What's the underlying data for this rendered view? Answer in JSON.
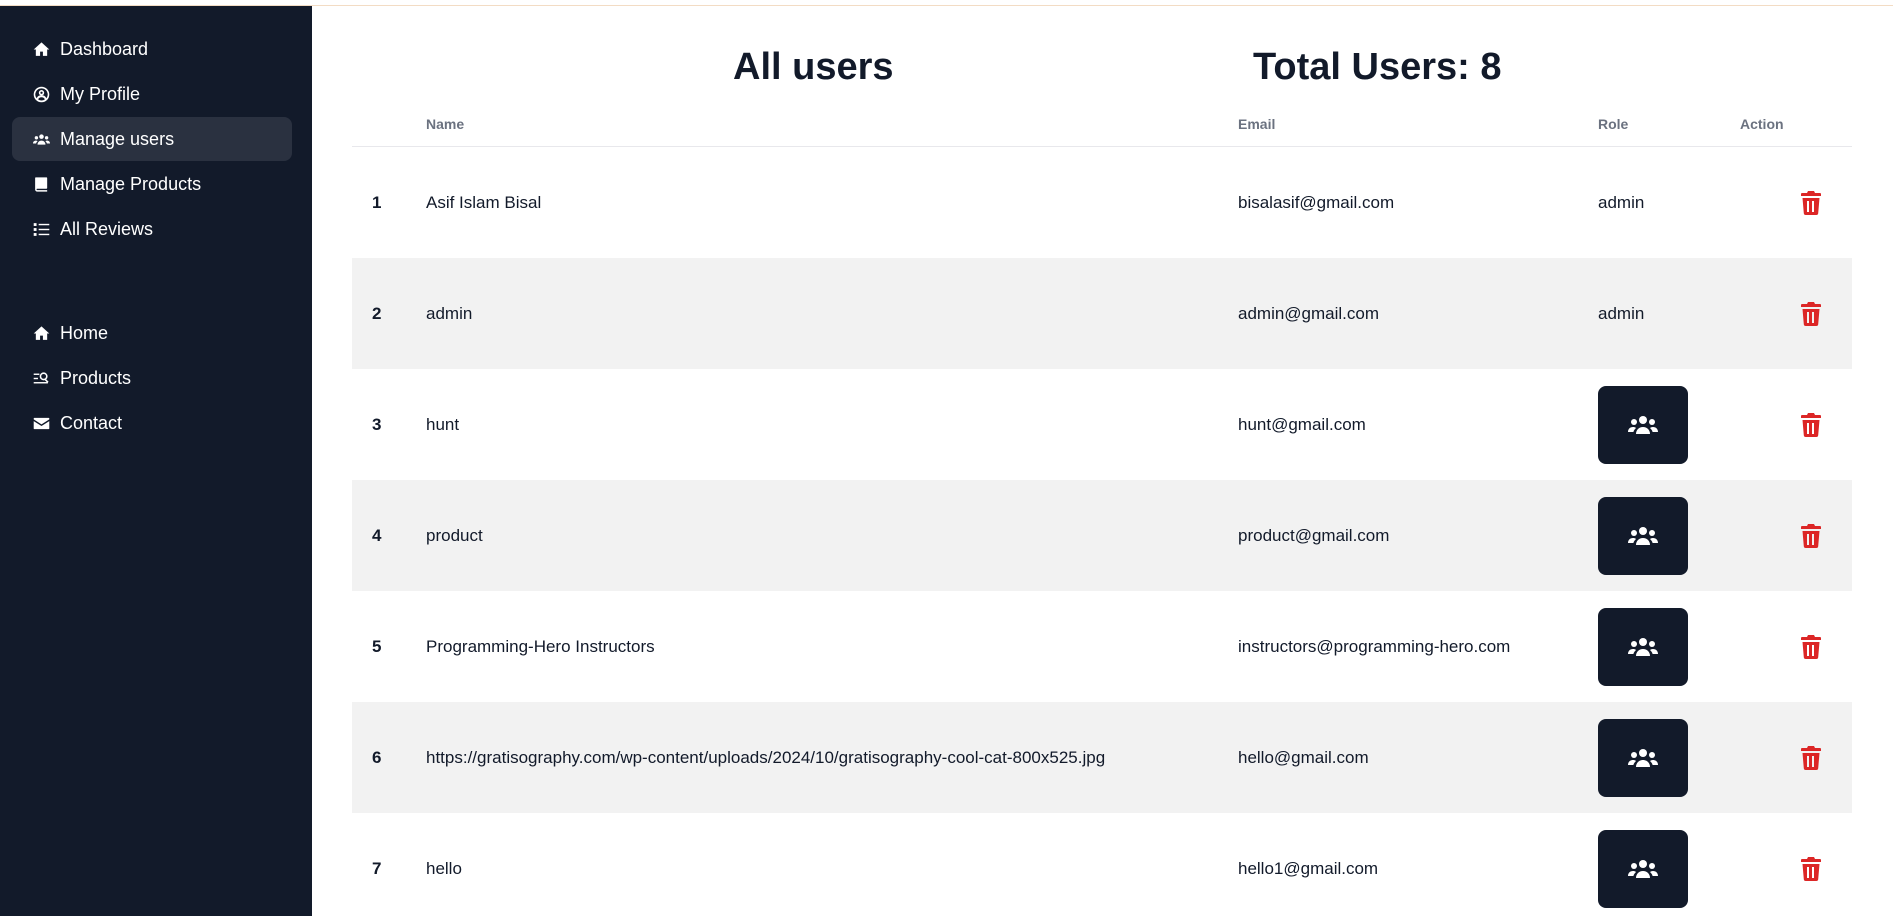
{
  "sidebar": {
    "primary_items": [
      {
        "label": "Dashboard",
        "icon": "home-icon"
      },
      {
        "label": "My Profile",
        "icon": "user-circle-icon"
      },
      {
        "label": "Manage users",
        "icon": "users-icon",
        "active": true
      },
      {
        "label": "Manage Products",
        "icon": "book-icon"
      },
      {
        "label": "All Reviews",
        "icon": "list-icon"
      }
    ],
    "secondary_items": [
      {
        "label": "Home",
        "icon": "home-icon"
      },
      {
        "label": "Products",
        "icon": "search-list-icon"
      },
      {
        "label": "Contact",
        "icon": "envelope-icon"
      }
    ]
  },
  "header": {
    "title": "All users",
    "total_label": "Total Users: 8"
  },
  "table": {
    "columns": [
      "",
      "Name",
      "Email",
      "Role",
      "Action"
    ],
    "rows": [
      {
        "index": "1",
        "name": "Asif Islam Bisal",
        "email": "bisalasif@gmail.com",
        "role": "admin"
      },
      {
        "index": "2",
        "name": "admin",
        "email": "admin@gmail.com",
        "role": "admin"
      },
      {
        "index": "3",
        "name": "hunt",
        "email": "hunt@gmail.com",
        "role": ""
      },
      {
        "index": "4",
        "name": "product",
        "email": "product@gmail.com",
        "role": ""
      },
      {
        "index": "5",
        "name": "Programming-Hero Instructors",
        "email": "instructors@programming-hero.com",
        "role": ""
      },
      {
        "index": "6",
        "name": "https://gratisography.com/wp-content/uploads/2024/10/gratisography-cool-cat-800x525.jpg",
        "email": "hello@gmail.com",
        "role": ""
      },
      {
        "index": "7",
        "name": "hello",
        "email": "hello1@gmail.com",
        "role": ""
      }
    ]
  },
  "colors": {
    "sidebar_bg": "#121a2a",
    "active_item_bg": "#2a3140",
    "striped_row_bg": "#f2f2f2",
    "delete_icon": "#dc2626",
    "role_button_bg": "#121a2a"
  }
}
